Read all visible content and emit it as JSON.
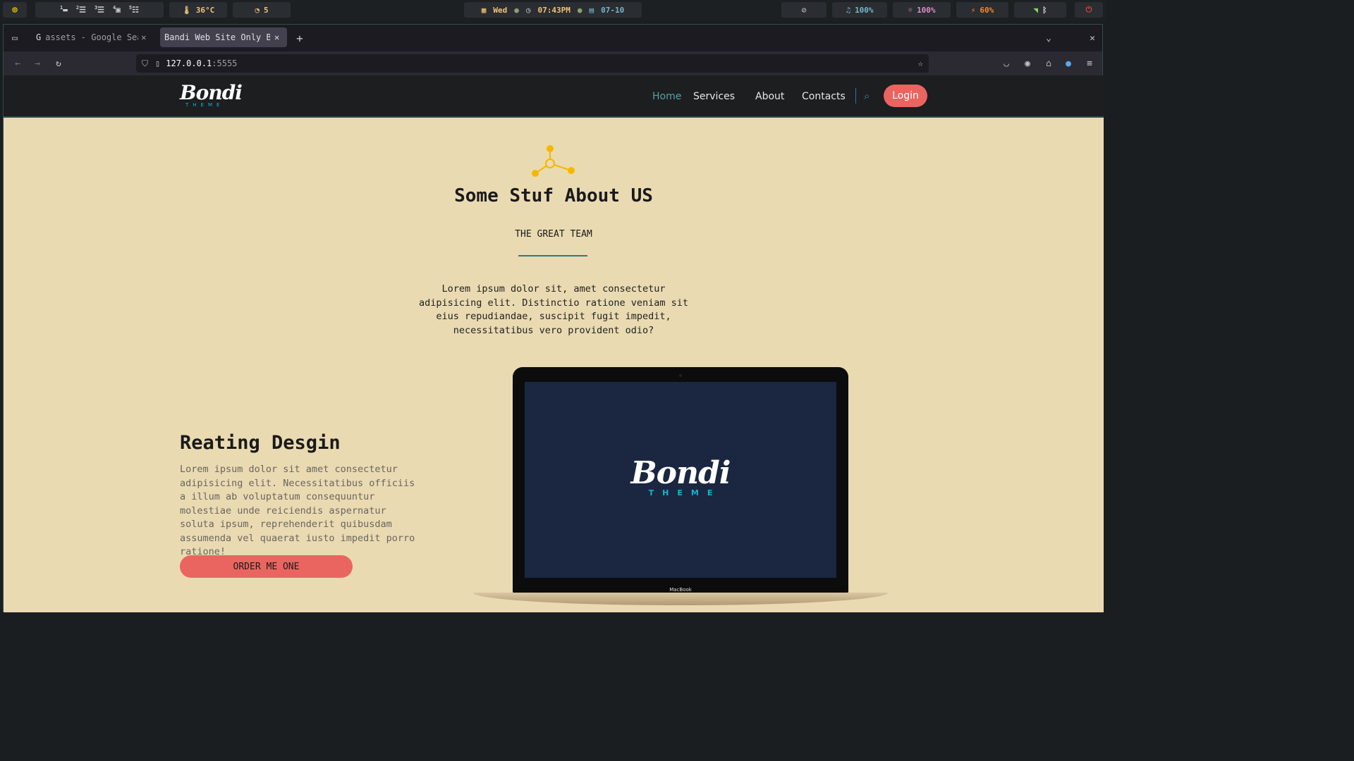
{
  "sysbar": {
    "workspaces": [
      "1",
      "2",
      "3",
      "4",
      "5"
    ],
    "temperature": "36°C",
    "gpu": "5",
    "day": "Wed",
    "time": "07:43PM",
    "date": "07-10",
    "volume": "100%",
    "brightness": "100%",
    "battery": "60%"
  },
  "browser": {
    "tabs": [
      {
        "label": "assets - Google Sea"
      },
      {
        "label": "Bandi Web Site Only B"
      }
    ],
    "url_host": "127.0.0.1",
    "url_port": ":5555"
  },
  "site": {
    "logo_main": "Bondi",
    "logo_sub": "THEME",
    "menu": {
      "home": "Home",
      "services": "Services",
      "about": "About",
      "contacts": "Contacts"
    },
    "login": "Login",
    "hero": {
      "title": "Some Stuf About US",
      "subtitle": "THE GREAT TEAM",
      "description": "Lorem ipsum dolor sit, amet consectetur adipisicing elit. Distinctio ratione veniam sit eius repudiandae, suscipit fugit impedit, necessitatibus vero provident odio?"
    },
    "feature": {
      "title": "Reating Desgin",
      "description": "Lorem ipsum dolor sit amet consectetur adipisicing elit. Necessitatibus officiis a illum ab voluptatum consequuntur molestiae unde reiciendis aspernatur soluta ipsum, reprehenderit quibusdam assumenda vel quaerat iusto impedit porro ratione!",
      "button": "ORDER ME ONE"
    },
    "laptop_brand": "MacBook",
    "screen_logo_main": "Bondi",
    "screen_logo_sub": "THEME"
  },
  "colors": {
    "page_bg": "#e9dab1",
    "accent_red": "#ea6560",
    "accent_teal": "#17b5cf",
    "icon_yellow": "#f5b800"
  }
}
